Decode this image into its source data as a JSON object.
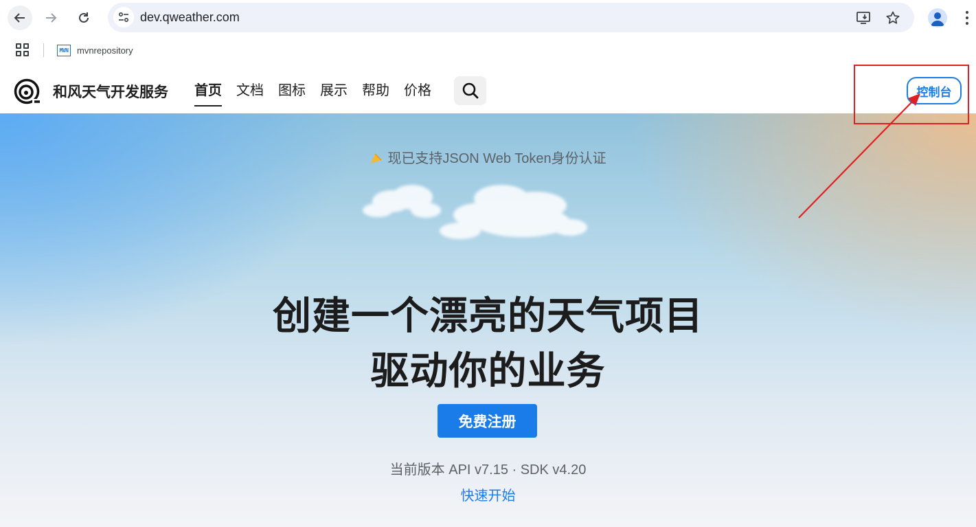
{
  "browser": {
    "url": "dev.qweather.com",
    "icons": [
      "back-icon",
      "forward-icon",
      "reload-icon",
      "site-info-icon",
      "install-icon",
      "star-icon",
      "profile-icon",
      "menu-icon"
    ]
  },
  "bookmarks": {
    "items": [
      {
        "label": "mvnrepository",
        "icon_text": "MVN"
      }
    ]
  },
  "header": {
    "brand": "和风天气开发服务",
    "nav": [
      {
        "label": "首页",
        "active": true
      },
      {
        "label": "文档"
      },
      {
        "label": "图标"
      },
      {
        "label": "展示"
      },
      {
        "label": "帮助"
      },
      {
        "label": "价格"
      }
    ],
    "console_label": "控制台"
  },
  "hero": {
    "badge": "现已支持JSON Web Token身份认证",
    "headline_1": "创建一个漂亮的天气项目",
    "headline_2": "驱动你的业务",
    "signup_label": "免费注册",
    "version": "当前版本 API v7.15 · SDK v4.20",
    "quickstart_label": "快速开始"
  },
  "colors": {
    "accent": "#1a7ce8",
    "annotation": "#e02020"
  }
}
